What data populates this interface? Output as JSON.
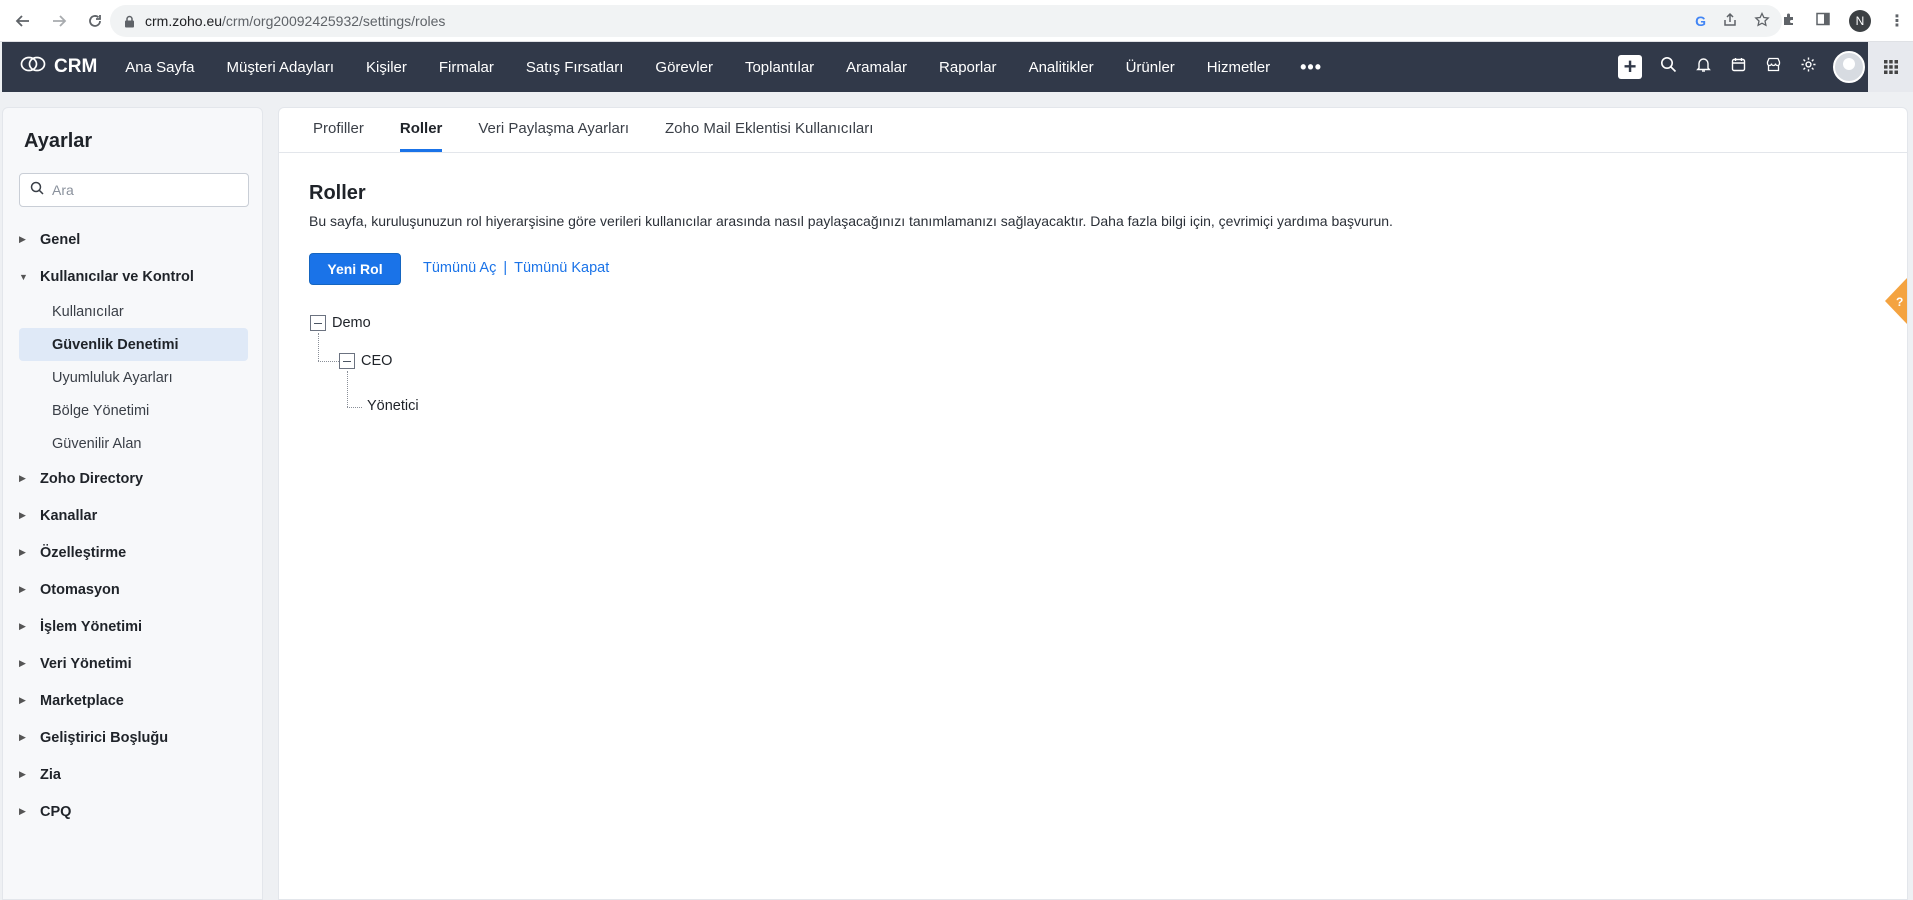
{
  "browser": {
    "url_host": "crm.zoho.eu",
    "url_path": "/crm/org20092425932/settings/roles",
    "profile_initial": "N"
  },
  "topnav": {
    "brand": "CRM",
    "items": [
      "Ana Sayfa",
      "Müşteri Adayları",
      "Kişiler",
      "Firmalar",
      "Satış Fırsatları",
      "Görevler",
      "Toplantılar",
      "Aramalar",
      "Raporlar",
      "Analitikler",
      "Ürünler",
      "Hizmetler"
    ],
    "more": "•••"
  },
  "sidebar": {
    "title": "Ayarlar",
    "search_placeholder": "Ara",
    "sections": [
      {
        "label": "Genel",
        "expanded": false
      },
      {
        "label": "Kullanıcılar ve Kontrol",
        "expanded": true,
        "children": [
          {
            "label": "Kullanıcılar",
            "active": false
          },
          {
            "label": "Güvenlik Denetimi",
            "active": true
          },
          {
            "label": "Uyumluluk Ayarları",
            "active": false
          },
          {
            "label": "Bölge Yönetimi",
            "active": false
          },
          {
            "label": "Güvenilir Alan",
            "active": false
          }
        ]
      },
      {
        "label": "Zoho Directory",
        "expanded": false
      },
      {
        "label": "Kanallar",
        "expanded": false
      },
      {
        "label": "Özelleştirme",
        "expanded": false
      },
      {
        "label": "Otomasyon",
        "expanded": false
      },
      {
        "label": "İşlem Yönetimi",
        "expanded": false
      },
      {
        "label": "Veri Yönetimi",
        "expanded": false
      },
      {
        "label": "Marketplace",
        "expanded": false
      },
      {
        "label": "Geliştirici Boşluğu",
        "expanded": false
      },
      {
        "label": "Zia",
        "expanded": false
      },
      {
        "label": "CPQ",
        "expanded": false
      }
    ]
  },
  "main": {
    "tabs": [
      {
        "label": "Profiller",
        "active": false
      },
      {
        "label": "Roller",
        "active": true
      },
      {
        "label": "Veri Paylaşma Ayarları",
        "active": false
      },
      {
        "label": "Zoho Mail Eklentisi Kullanıcıları",
        "active": false
      }
    ],
    "title": "Roller",
    "description": "Bu sayfa, kuruluşunuzun rol hiyerarşisine göre verileri kullanıcılar arasında nasıl paylaşacağınızı tanımlamanızı sağlayacaktır. Daha fazla bilgi için, çevrimiçi yardıma başvurun.",
    "new_role_button": "Yeni Rol",
    "expand_all": "Tümünü Aç",
    "separator": "|",
    "collapse_all": "Tümünü Kapat",
    "tree": {
      "root": "Demo",
      "child": "CEO",
      "grandchild": "Yönetici"
    },
    "help": "?"
  },
  "colors": {
    "topnav_bg": "#313949",
    "accent": "#1a73e8",
    "active_item_bg": "#dfe9f7",
    "help_tab": "#f4a340"
  }
}
